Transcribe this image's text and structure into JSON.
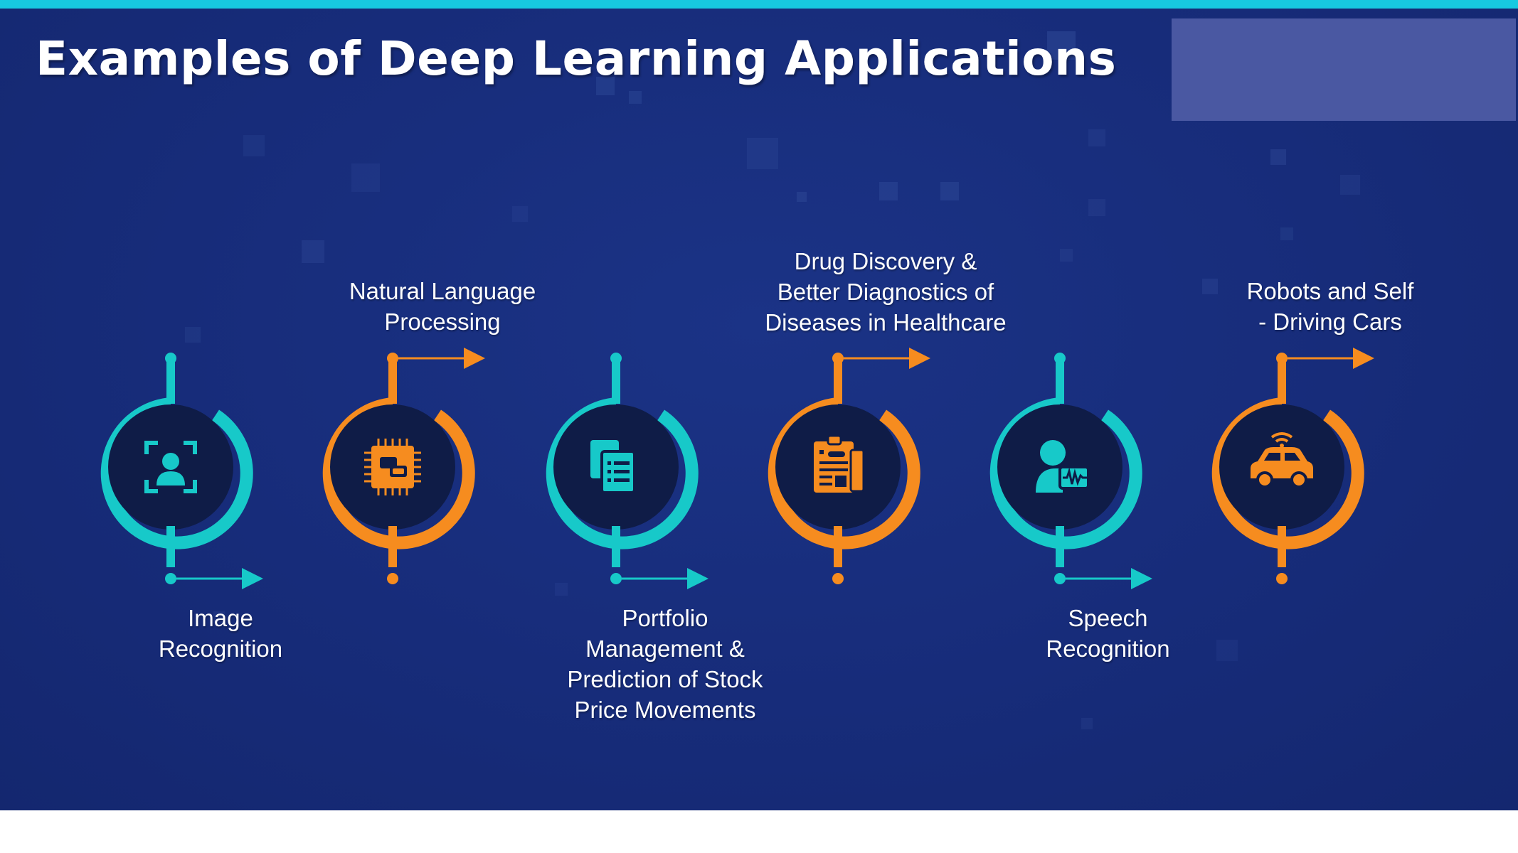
{
  "slide": {
    "title": "Examples of Deep Learning Applications"
  },
  "colors": {
    "background": "#172c7a",
    "accent_top_rule": "#17c9e0",
    "teal": "#17c9c9",
    "orange": "#f68c1f",
    "circle_fill": "#0f1c47",
    "logo_box": "#4a58a2"
  },
  "applications": [
    {
      "label": "Image\nRecognition",
      "icon": "face-scan-icon",
      "color": "teal"
    },
    {
      "label": "Natural Language\nProcessing",
      "icon": "chip-chat-icon",
      "color": "orange"
    },
    {
      "label": "Portfolio\nManagement &\nPrediction of Stock\nPrice Movements",
      "icon": "documents-icon",
      "color": "teal"
    },
    {
      "label": "Drug Discovery &\nBetter Diagnostics of\nDiseases in Healthcare",
      "icon": "clipboard-report-icon",
      "color": "orange"
    },
    {
      "label": "Speech\nRecognition",
      "icon": "voice-profile-icon",
      "color": "teal"
    },
    {
      "label": "Robots and Self\n- Driving Cars",
      "icon": "connected-car-icon",
      "color": "orange"
    }
  ]
}
